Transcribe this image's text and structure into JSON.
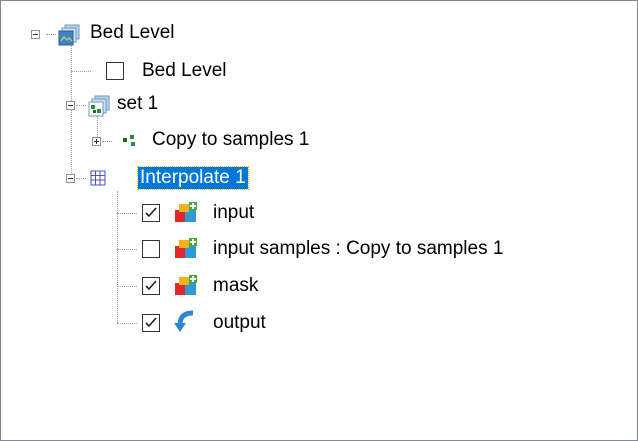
{
  "tree": {
    "root": {
      "label": "Bed Level",
      "icon": "stack-layers-icon"
    },
    "bed_level_item": {
      "label": "Bed Level",
      "checked": false
    },
    "set": {
      "label": "set 1",
      "icon": "stack-layers-icon"
    },
    "copy": {
      "label": "Copy to samples 1",
      "icon": "samples-icon"
    },
    "interpolate": {
      "label": "Interpolate 1",
      "icon": "grid-icon",
      "selected": true,
      "children": [
        {
          "label": "input",
          "checked": true,
          "icon": "blocks-plus-icon"
        },
        {
          "label": "input samples : Copy to samples 1",
          "checked": false,
          "icon": "blocks-plus-icon"
        },
        {
          "label": "mask",
          "checked": true,
          "icon": "blocks-plus-icon"
        },
        {
          "label": "output",
          "checked": true,
          "icon": "arrow-return-icon"
        }
      ]
    }
  },
  "colors": {
    "selection": "#0078d7",
    "tree_lines": "#a0a0a0"
  }
}
